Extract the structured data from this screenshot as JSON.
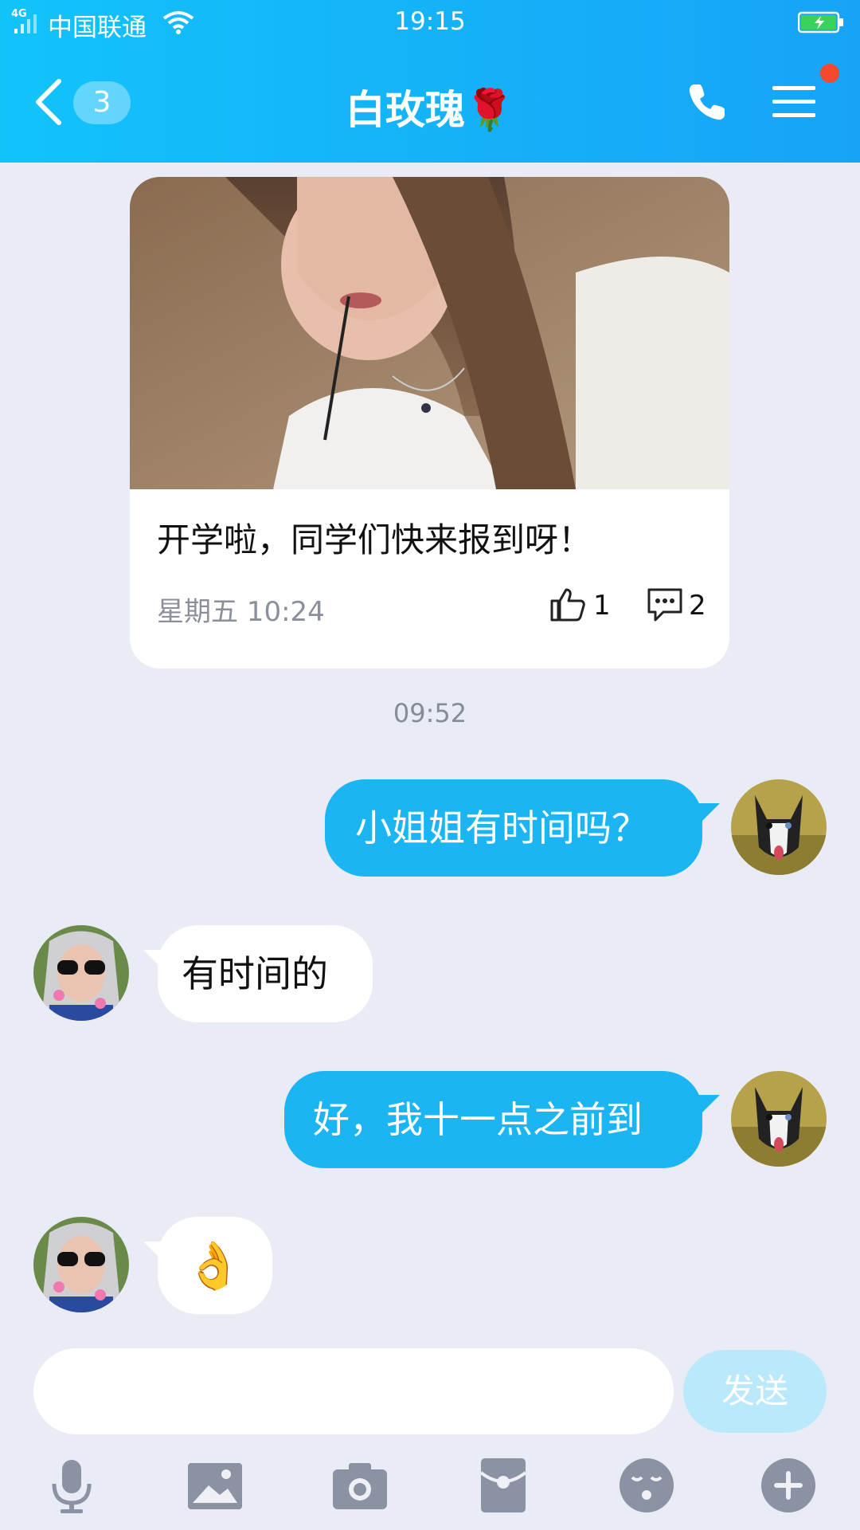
{
  "status_bar": {
    "network": "4G",
    "carrier": "中国联通",
    "time": "19:15"
  },
  "nav": {
    "unread_count": "3",
    "title": "白玫瑰🌹"
  },
  "shared_post": {
    "text": "开学啦，同学们快来报到呀！",
    "date": "星期五 10:24",
    "likes": "1",
    "comments": "2"
  },
  "timestamp": "09:52",
  "messages": [
    {
      "side": "out",
      "text": "小姐姐有时间吗？"
    },
    {
      "side": "in",
      "text": "有时间的"
    },
    {
      "side": "out",
      "text": "好，我十一点之前到"
    },
    {
      "side": "in",
      "text": "👌"
    }
  ],
  "input": {
    "placeholder": "",
    "send_label": "发送"
  },
  "toolbar": [
    "microphone-icon",
    "image-icon",
    "camera-icon",
    "red-packet-icon",
    "emoji-icon",
    "plus-icon"
  ],
  "colors": {
    "header": "#15b1f8",
    "outgoing_bubble": "#1cb5f4",
    "incoming_bubble": "#ffffff",
    "background": "#e9ecf4",
    "badge_dot": "#f5492f",
    "send_disabled": "#b9e9fb"
  }
}
